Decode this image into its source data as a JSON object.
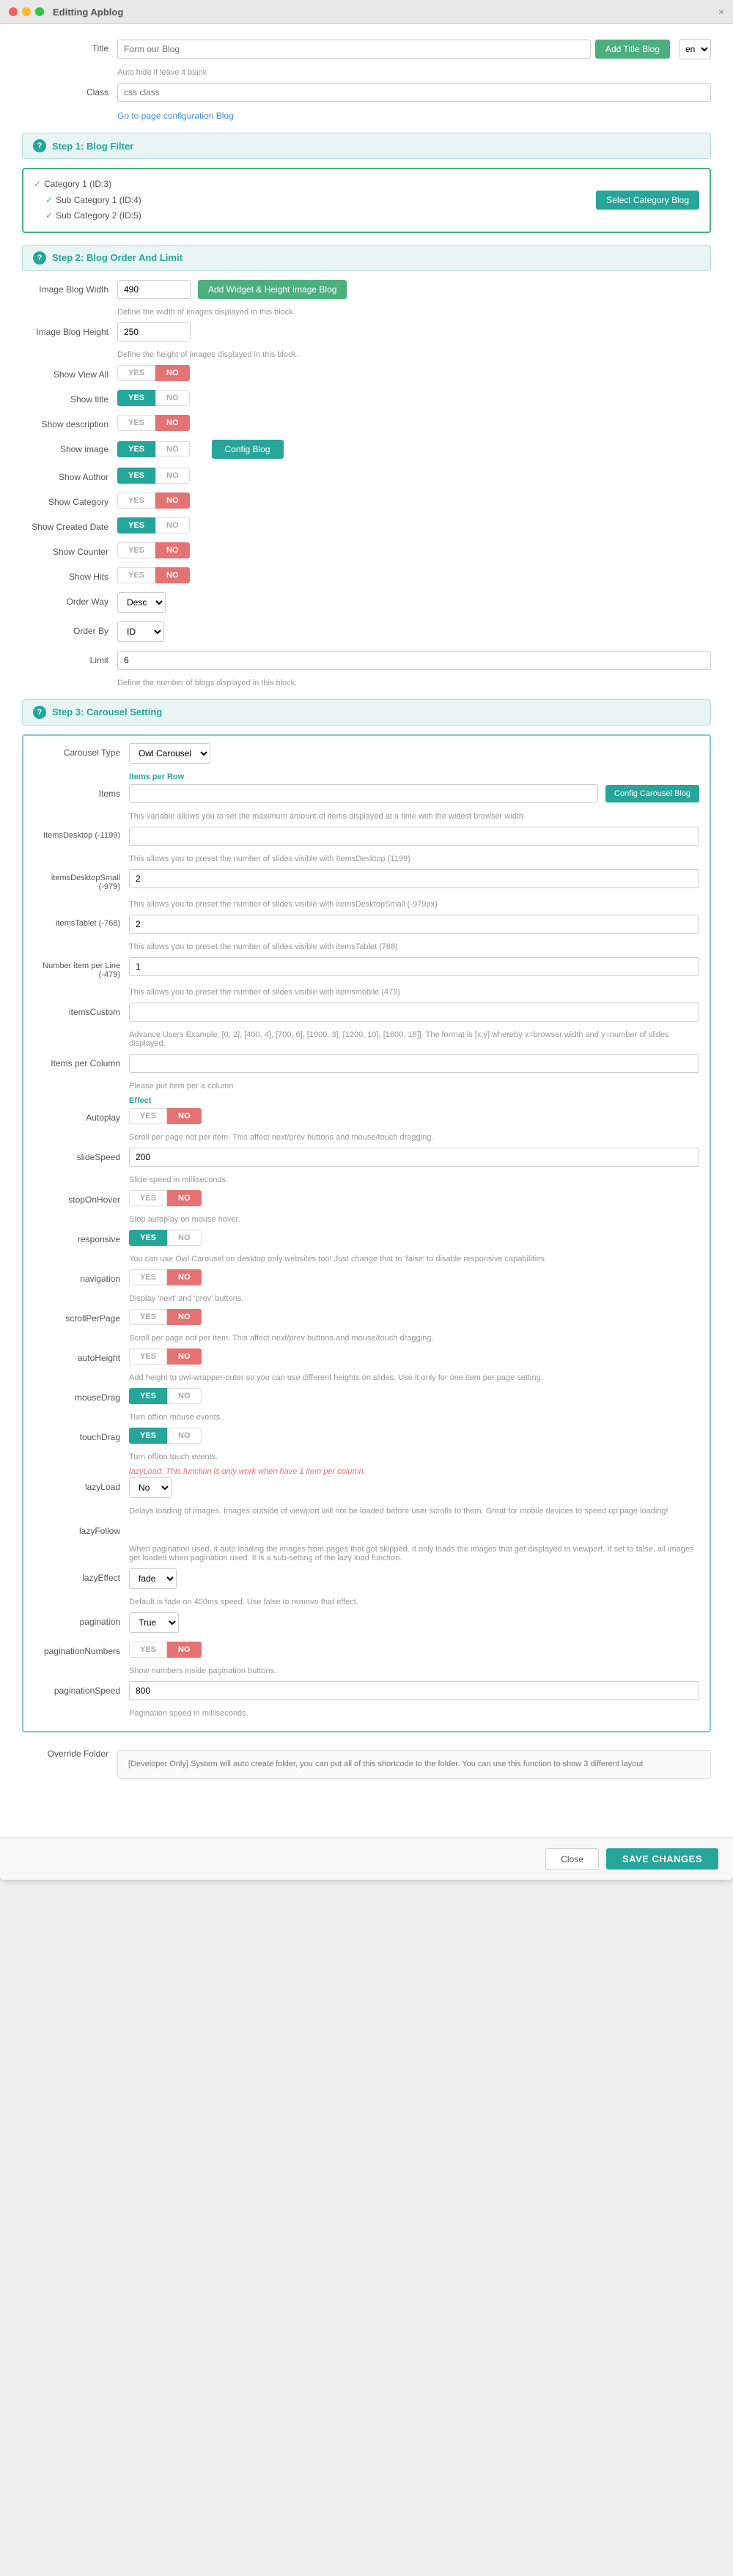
{
  "window": {
    "title": "Editting Apblog",
    "close_label": "×"
  },
  "header": {
    "title_label": "Title",
    "title_placeholder": "Form our Blog",
    "add_title_btn": "Add Title Blog",
    "auto_hide_hint": "Auto hide if leave it blank",
    "lang_option": "en"
  },
  "class_field": {
    "label": "Class",
    "placeholder": "css class"
  },
  "config_link": "Go to page configuration Blog",
  "step1": {
    "header": "Step 1: Blog Filter",
    "categories": {
      "cat1": "Category 1 (ID:3)",
      "subcat1": "Sub Category 1 (ID:4)",
      "subcat2": "Sub Category 2 (ID:5)"
    },
    "select_btn": "Select Category Blog"
  },
  "step2": {
    "header": "Step 2: Blog Order And Limit",
    "image_blog_width_label": "Image Blog Width",
    "image_blog_width_value": "490",
    "image_blog_width_hint": "Define the width of images displayed in this block.",
    "add_widget_btn": "Add Widget & Height Image Blog",
    "image_blog_height_label": "Image Blog Height",
    "image_blog_height_value": "250",
    "image_blog_height_hint": "Define the height of images displayed in this block.",
    "show_view_all_label": "Show View All",
    "show_view_all_yes": "YES",
    "show_view_all_no": "NO",
    "show_view_all_state": "no",
    "show_title_label": "Show title",
    "show_title_yes": "YES",
    "show_title_no": "NO",
    "show_title_state": "yes",
    "show_description_label": "Show description",
    "show_description_yes": "YES",
    "show_description_no": "NO",
    "show_description_state": "no",
    "show_image_label": "Show image",
    "show_image_yes": "YES",
    "show_image_no": "NO",
    "show_image_state": "yes",
    "show_author_label": "Show Author",
    "show_author_yes": "YES",
    "show_author_no": "NO",
    "show_author_state": "yes",
    "show_category_label": "Show Category",
    "show_category_yes": "YES",
    "show_category_no": "NO",
    "show_category_state": "no",
    "show_created_date_label": "Show Created Date",
    "show_created_date_yes": "YES",
    "show_created_date_no": "NO",
    "show_created_date_state": "yes",
    "show_counter_label": "Show Counter",
    "show_counter_yes": "YES",
    "show_counter_no": "NO",
    "show_counter_state": "no",
    "show_hits_label": "Show Hits",
    "show_hits_yes": "YES",
    "show_hits_no": "NO",
    "show_hits_state": "no",
    "order_way_label": "Order Way",
    "order_way_value": "Desc",
    "order_by_label": "Order By",
    "order_by_value": "ID",
    "limit_label": "Limit",
    "limit_value": "6",
    "limit_hint": "Define the number of blogs displayed in this block.",
    "config_btn": "Config Blog"
  },
  "step3": {
    "header": "Step 3: Carousel Setting",
    "carousel_type_label": "Carousel Type",
    "carousel_type_value": "Owl Carousel",
    "items_per_row_section": "Items per Row",
    "items_label": "Items",
    "items_value": "",
    "items_hint": "This variable allows you to set the maximum amount of items displayed at a time with the widest browser width",
    "items_desktop_label": "ItemsDesktop (-1199)",
    "items_desktop_value": "",
    "items_desktop_hint": "This allows you to preset the number of slides visible with ItemsDesktop (1199)",
    "items_desktop_small_label": "itemsDesktopSmall (-979)",
    "items_desktop_small_value": "",
    "items_desktop_small_hint": "This allows you to preset the number of slides visible with itemsDesktopSmall (-979px)",
    "items_tablet_label": "itemsTablet (-768)",
    "items_tablet_value": "2",
    "items_tablet_hint": "This allows you to preset the number of slides visible with itemsTablet (768)",
    "number_item_per_line_label": "Number item per Line (-479)",
    "number_item_per_line_value": "1",
    "number_item_per_line_hint": "This allows you to preset the number of slides visible with itemsmobile (479)",
    "items_custom_label": "itemsCustom",
    "items_custom_value": "",
    "items_custom_hint": "Advance Users Example: [0, 2], [400, 4], [700, 6], [1000, 3], [1200, 10], [1600, 16]]. The format is [x,y] whereby x=browser width and y=number of slides displayed.",
    "items_per_column_label": "Items per Column",
    "items_per_column_value": "",
    "items_per_column_hint": "Please put item per a column",
    "effect_section": "Effect",
    "autoplay_label": "Autoplay",
    "autoplay_yes": "YES",
    "autoplay_no": "NO",
    "autoplay_state": "no",
    "autoplay_hint": "Scroll per page not per item. This affect next/prev buttons and mouse/touch dragging.",
    "slide_speed_label": "slideSpeed",
    "slide_speed_value": "200",
    "slide_speed_hint": "Slide speed in milliseconds.",
    "stop_on_hover_label": "stopOnHover",
    "stop_on_hover_yes": "YES",
    "stop_on_hover_no": "NO",
    "stop_on_hover_state": "no",
    "stop_on_hover_hint": "Stop autoplay on mouse hover.",
    "responsive_label": "responsive",
    "responsive_yes": "YES",
    "responsive_no": "NO",
    "responsive_state": "yes",
    "responsive_hint": "You can use Owl Carousel on desktop only websites too! Just change that to 'false' to disable responsive capabilities",
    "navigation_label": "navigation",
    "navigation_yes": "YES",
    "navigation_no": "NO",
    "navigation_state": "no",
    "navigation_hint": "Display 'next' and 'prev' buttons.",
    "scroll_per_page_label": "scrollPerPage",
    "scroll_per_page_yes": "YES",
    "scroll_per_page_no": "NO",
    "scroll_per_page_state": "no",
    "scroll_per_page_hint": "Scroll per page not per item. This affect next/prev buttons and mouse/touch dragging.",
    "auto_height_label": "autoHeight",
    "auto_height_yes": "YES",
    "auto_height_no": "NO",
    "auto_height_state": "no",
    "auto_height_hint": "Add height to owl-wrapper-outer so you can use different heights on slides. Use it only for one item per page setting.",
    "mouse_drag_label": "mouseDrag",
    "mouse_drag_yes": "YES",
    "mouse_drag_no": "NO",
    "mouse_drag_state": "yes",
    "mouse_drag_hint": "Turn off/on mouse events.",
    "touch_drag_label": "touchDrag",
    "touch_drag_yes": "YES",
    "touch_drag_no": "NO",
    "touch_drag_state": "yes",
    "touch_drag_hint": "Turn off/on touch events.",
    "lazy_note": "lazyLoad: This function is only work when have 1 item per column.",
    "lazy_load_label": "lazyLoad",
    "lazy_load_value": "No",
    "lazy_load_hint": "Delays loading of images. Images outside of viewport will not be loaded before user scrolls to them. Great for mobile devices to speed up page loading!",
    "lazy_follow_label": "lazyFollow",
    "lazy_follow_hint": "When pagination used, it auto loading the images from pages that got skipped. It only loads the images that get displayed in viewport. If set to false, all images get loaded when pagination used. It is a sub-setting of the lazy load function.",
    "lazy_effect_label": "lazyEffect",
    "lazy_effect_value": "fade",
    "lazy_effect_hint": "Default is fade on 400ms speed. Use false to remove that effect.",
    "pagination_label": "pagination",
    "pagination_value": "True",
    "pagination_numbers_label": "paginationNumbers",
    "pagination_numbers_yes": "YES",
    "pagination_numbers_no": "NO",
    "pagination_numbers_state": "no",
    "pagination_numbers_hint": "Show numbers inside pagination buttons.",
    "pagination_speed_label": "paginationSpeed",
    "pagination_speed_value": "800",
    "pagination_speed_hint": "Pagination speed in milliseconds.",
    "config_carousel_btn": "Config Carousel Blog"
  },
  "override_folder": {
    "label": "Override Folder",
    "hint": "[Developer Only] System will auto create folder, you can put all of this shortcode to the folder. You can use this function to show 3 different layout"
  },
  "footer": {
    "close_btn": "Close",
    "save_btn": "SAVE CHANGES"
  }
}
